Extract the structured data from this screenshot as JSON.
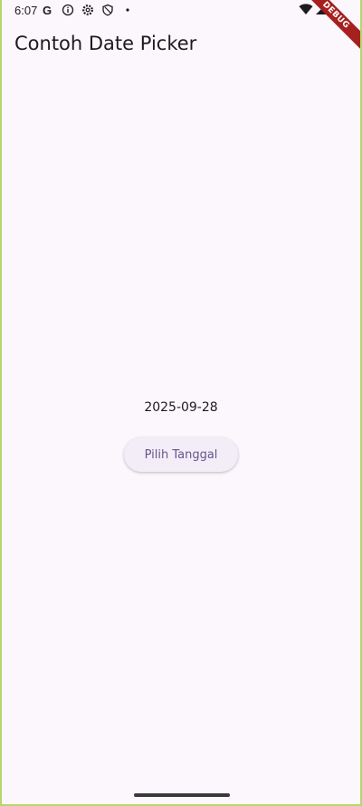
{
  "status_bar": {
    "time": "6:07",
    "g_label": "G",
    "icons": [
      "google-icon",
      "info-icon",
      "settings-icon",
      "shield-icon",
      "dot-icon",
      "wifi-icon",
      "signal-icon"
    ]
  },
  "debug_banner": {
    "label": "DEBUG"
  },
  "app_bar": {
    "title": "Contoh Date Picker"
  },
  "main": {
    "selected_date": "2025-09-28",
    "pick_button_label": "Pilih Tanggal"
  },
  "colors": {
    "background": "#fbf7fd",
    "button_background": "#f3edf7",
    "button_text": "#65558f",
    "debug_banner": "#a5201e"
  }
}
